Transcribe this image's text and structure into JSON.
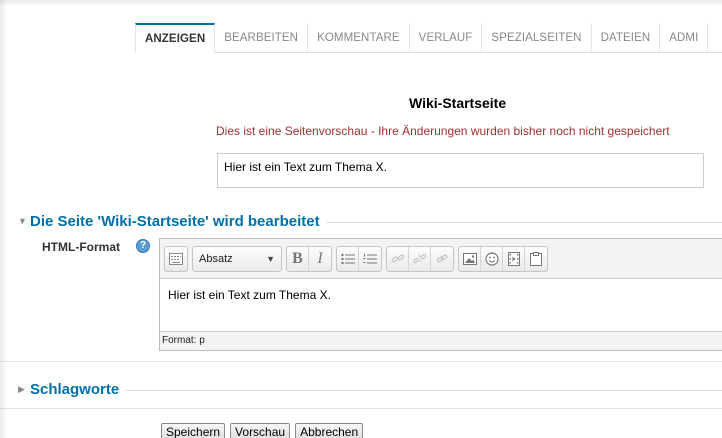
{
  "tabs": [
    {
      "label": "ANZEIGEN",
      "active": true
    },
    {
      "label": "BEARBEITEN",
      "active": false
    },
    {
      "label": "KOMMENTARE",
      "active": false
    },
    {
      "label": "VERLAUF",
      "active": false
    },
    {
      "label": "SPEZIALSEITEN",
      "active": false
    },
    {
      "label": "DATEIEN",
      "active": false
    },
    {
      "label": "ADMI",
      "active": false
    }
  ],
  "page_title": "Wiki-Startseite",
  "preview_notice": "Dies ist eine Seitenvorschau - Ihre Änderungen wurden bisher noch nicht gespeichert",
  "preview_content": "Hier ist ein Text zum Thema X.",
  "edit_section": {
    "title": "Die Seite 'Wiki-Startseite' wird bearbeitet",
    "field_label": "HTML-Format",
    "help_icon": "question-icon",
    "editor": {
      "format_select": "Absatz",
      "toolbar_icons": [
        "toggle-toolbar-icon",
        "bold-icon",
        "italic-icon",
        "unordered-list-icon",
        "ordered-list-icon",
        "link-icon",
        "unlink-icon",
        "anchor-icon",
        "image-icon",
        "emoticon-icon",
        "media-icon",
        "paste-icon"
      ],
      "content": "Hier ist ein Text zum Thema X.",
      "status": "Format: p"
    }
  },
  "tags_section": {
    "title": "Schlagworte"
  },
  "buttons": {
    "save": "Speichern",
    "preview": "Vorschau",
    "cancel": "Abbrechen"
  },
  "colors": {
    "accent": "#0070a8",
    "notice": "#a33030"
  }
}
